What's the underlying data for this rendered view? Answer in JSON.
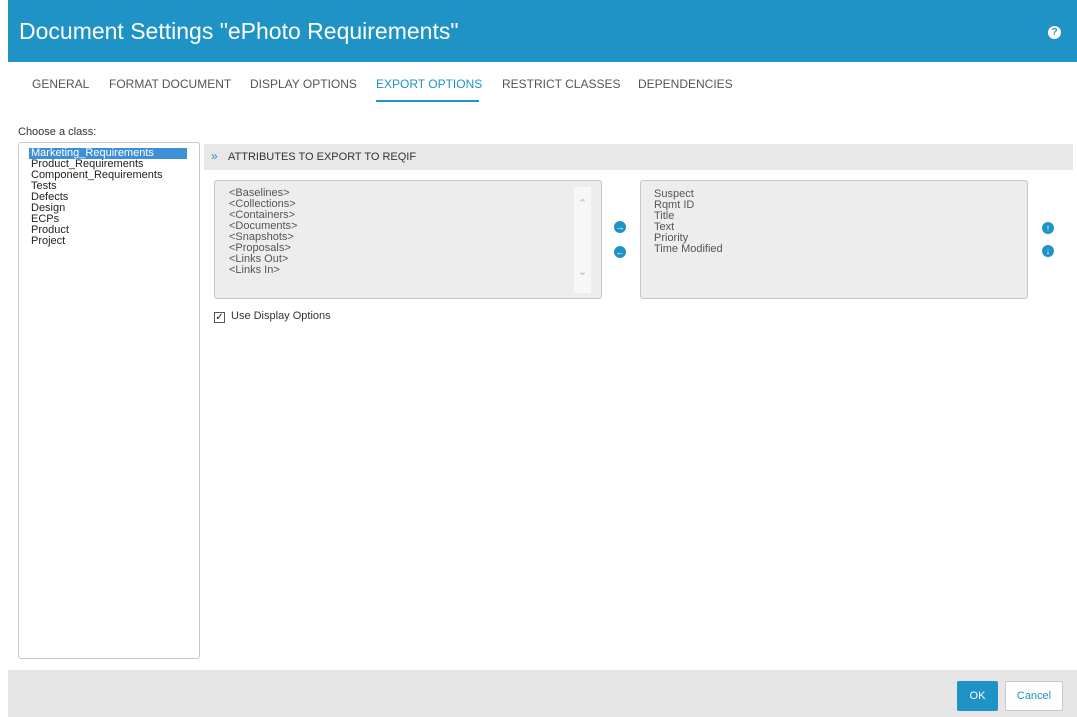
{
  "window": {
    "title": "Document Settings \"ePhoto Requirements\"",
    "help_icon": "question-circle-icon",
    "help_glyph": "?"
  },
  "tabs": [
    {
      "label": "GENERAL",
      "active": false
    },
    {
      "label": "FORMAT DOCUMENT",
      "active": false
    },
    {
      "label": "DISPLAY OPTIONS",
      "active": false
    },
    {
      "label": "EXPORT OPTIONS",
      "active": true
    },
    {
      "label": "RESTRICT CLASSES",
      "active": false
    },
    {
      "label": "DEPENDENCIES",
      "active": false
    }
  ],
  "class_panel": {
    "label": "Choose a class:",
    "items": [
      "Marketing_Requirements",
      "Product_Requirements",
      "Component_Requirements",
      "Tests",
      "Defects",
      "Design",
      "ECPs",
      "Product",
      "Project"
    ],
    "selected": "Marketing_Requirements"
  },
  "attributes": {
    "header": "ATTRIBUTES TO EXPORT TO REQIF",
    "header_icon": "double-chevron-down-icon",
    "available": [
      "<Baselines>",
      "<Collections>",
      "<Containers>",
      "<Documents>",
      "<Snapshots>",
      "<Proposals>",
      "<Links Out>",
      "<Links In>"
    ],
    "selected": [
      "Suspect",
      "Rqmt ID",
      "Title",
      "Text",
      "Priority",
      "Time Modified"
    ],
    "icons": {
      "add": "arrow-right-circle-icon",
      "remove": "arrow-left-circle-icon",
      "move_up": "arrow-up-circle-icon",
      "move_down": "arrow-down-circle-icon"
    }
  },
  "use_display_options": {
    "label": "Use Display Options",
    "checked": true
  },
  "footer": {
    "ok_label": "OK",
    "cancel_label": "Cancel"
  },
  "colors": {
    "accent": "#1f92c6",
    "selection": "#3f8fd6"
  }
}
